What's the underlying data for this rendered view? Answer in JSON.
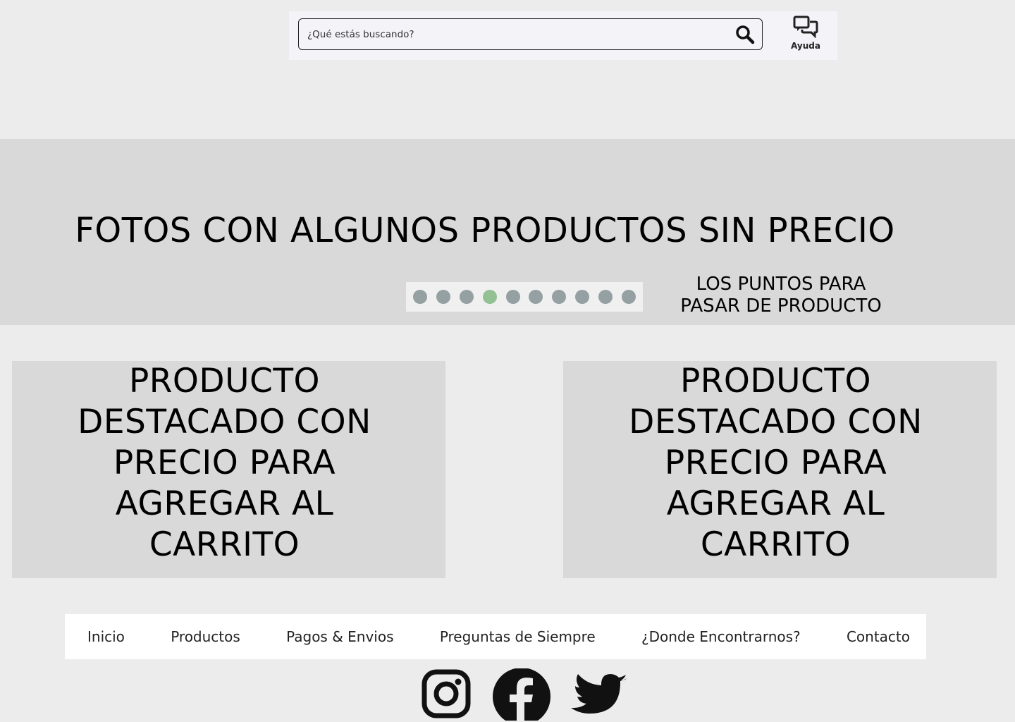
{
  "search": {
    "placeholder": "¿Qué estás buscando?"
  },
  "help": {
    "label": "Ayuda"
  },
  "hero": {
    "title": "FOTOS CON ALGUNOS PRODUCTOS SIN PRECIO",
    "dots_count": 10,
    "active_dot": 4,
    "dots_note_line1": "LOS PUNTOS PARA",
    "dots_note_line2": "PASAR DE PRODUCTO"
  },
  "products": [
    {
      "lines": [
        "PRODUCTO",
        "DESTACADO CON",
        "PRECIO PARA",
        "AGREGAR AL",
        "CARRITO"
      ]
    },
    {
      "lines": [
        "PRODUCTO",
        "DESTACADO CON",
        "PRECIO PARA",
        "AGREGAR AL",
        "CARRITO"
      ]
    }
  ],
  "nav": {
    "items": [
      {
        "label": "Inicio"
      },
      {
        "label": "Productos"
      },
      {
        "label": "Pagos & Envios"
      },
      {
        "label": "Preguntas de Siempre"
      },
      {
        "label": "¿Donde Encontrarnos?"
      },
      {
        "label": "Contacto"
      }
    ]
  },
  "social": {
    "icons": [
      "instagram-icon",
      "facebook-icon",
      "twitter-icon"
    ]
  },
  "colors": {
    "page_bg": "#ececec",
    "panel_bg": "#d9d9d9",
    "dot": "#95a0a2",
    "dot_active": "#93c194"
  }
}
